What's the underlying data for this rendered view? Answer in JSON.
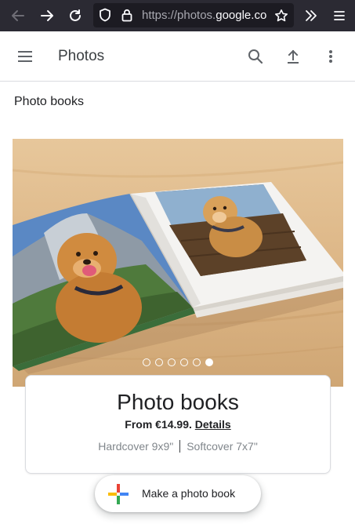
{
  "browser": {
    "url_prefix": "https://photos.",
    "url_domain": "google.com"
  },
  "header": {
    "title": "Photos"
  },
  "page": {
    "section_title": "Photo books"
  },
  "carousel": {
    "slide_count": 6,
    "active_index": 5
  },
  "product_card": {
    "title": "Photo books",
    "price_prefix": "From €14.99.",
    "details_link": "Details",
    "format_hardcover": "Hardcover 9x9\"",
    "format_softcover": "Softcover 7x7\""
  },
  "fab": {
    "label": "Make a photo book"
  },
  "icons": {
    "back": "arrow-left-icon",
    "forward": "arrow-right-icon",
    "reload": "reload-icon",
    "tracking": "shield-icon",
    "lock": "lock-icon",
    "bookmark": "star-icon",
    "overflow": "chevrons-right-icon",
    "browser_menu": "hamburger-icon",
    "app_menu": "hamburger-icon",
    "search": "search-icon",
    "upload": "upload-icon",
    "more": "more-vert-icon",
    "plus": "plus-icon"
  },
  "colors": {
    "browser_bg": "#2b2a33",
    "url_bg": "#1c1b22",
    "plus_blue": "#4285f4",
    "plus_red": "#ea4335",
    "plus_yellow": "#fbbc04",
    "plus_green": "#34a853"
  }
}
